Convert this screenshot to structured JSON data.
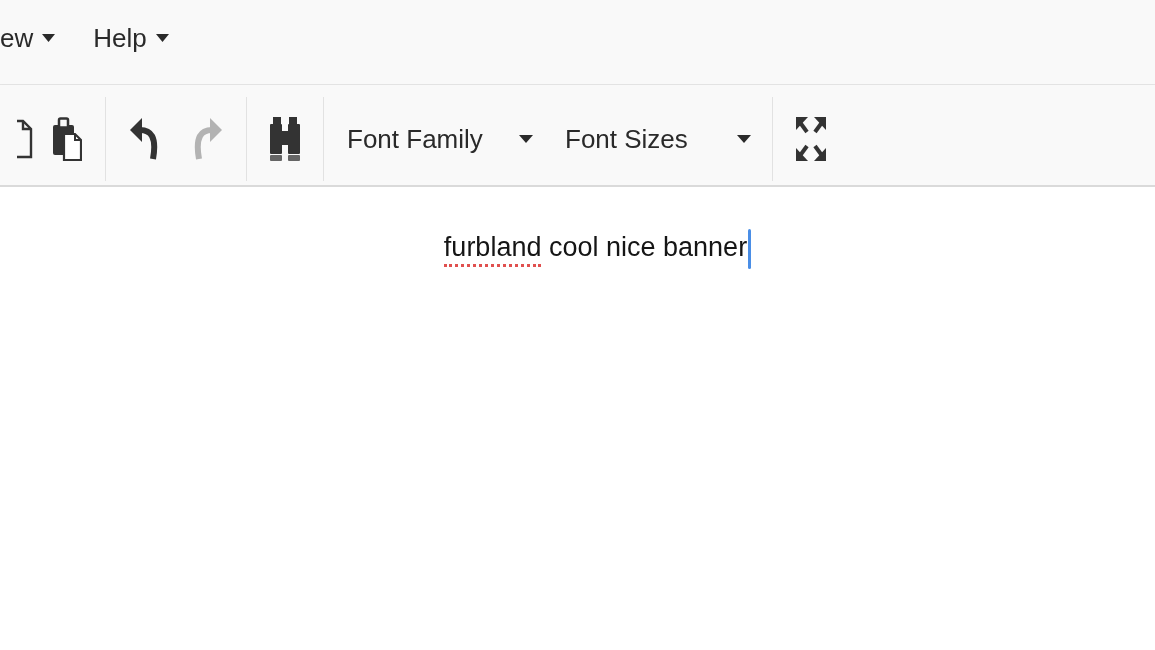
{
  "menubar": {
    "items": [
      {
        "label": "ew"
      },
      {
        "label": "Help"
      }
    ]
  },
  "toolbar": {
    "groups": [
      {
        "items": [
          {
            "kind": "copy",
            "disabled": false
          },
          {
            "kind": "paste",
            "disabled": false
          }
        ]
      },
      {
        "items": [
          {
            "kind": "undo",
            "disabled": false
          },
          {
            "kind": "redo",
            "disabled": true
          }
        ]
      },
      {
        "items": [
          {
            "kind": "find",
            "disabled": false
          }
        ]
      },
      {
        "items": [
          {
            "kind": "dropdown",
            "label": "Font Family",
            "disabled": false
          },
          {
            "kind": "dropdown",
            "label": "Font Sizes",
            "disabled": false
          }
        ]
      },
      {
        "items": [
          {
            "kind": "fullscreen",
            "disabled": false
          }
        ]
      }
    ]
  },
  "editor": {
    "words": [
      {
        "text": "furbland",
        "misspelled": true
      },
      {
        "text": "cool",
        "misspelled": false
      },
      {
        "text": "nice",
        "misspelled": false
      },
      {
        "text": "banner",
        "misspelled": false
      }
    ],
    "caret": true
  }
}
